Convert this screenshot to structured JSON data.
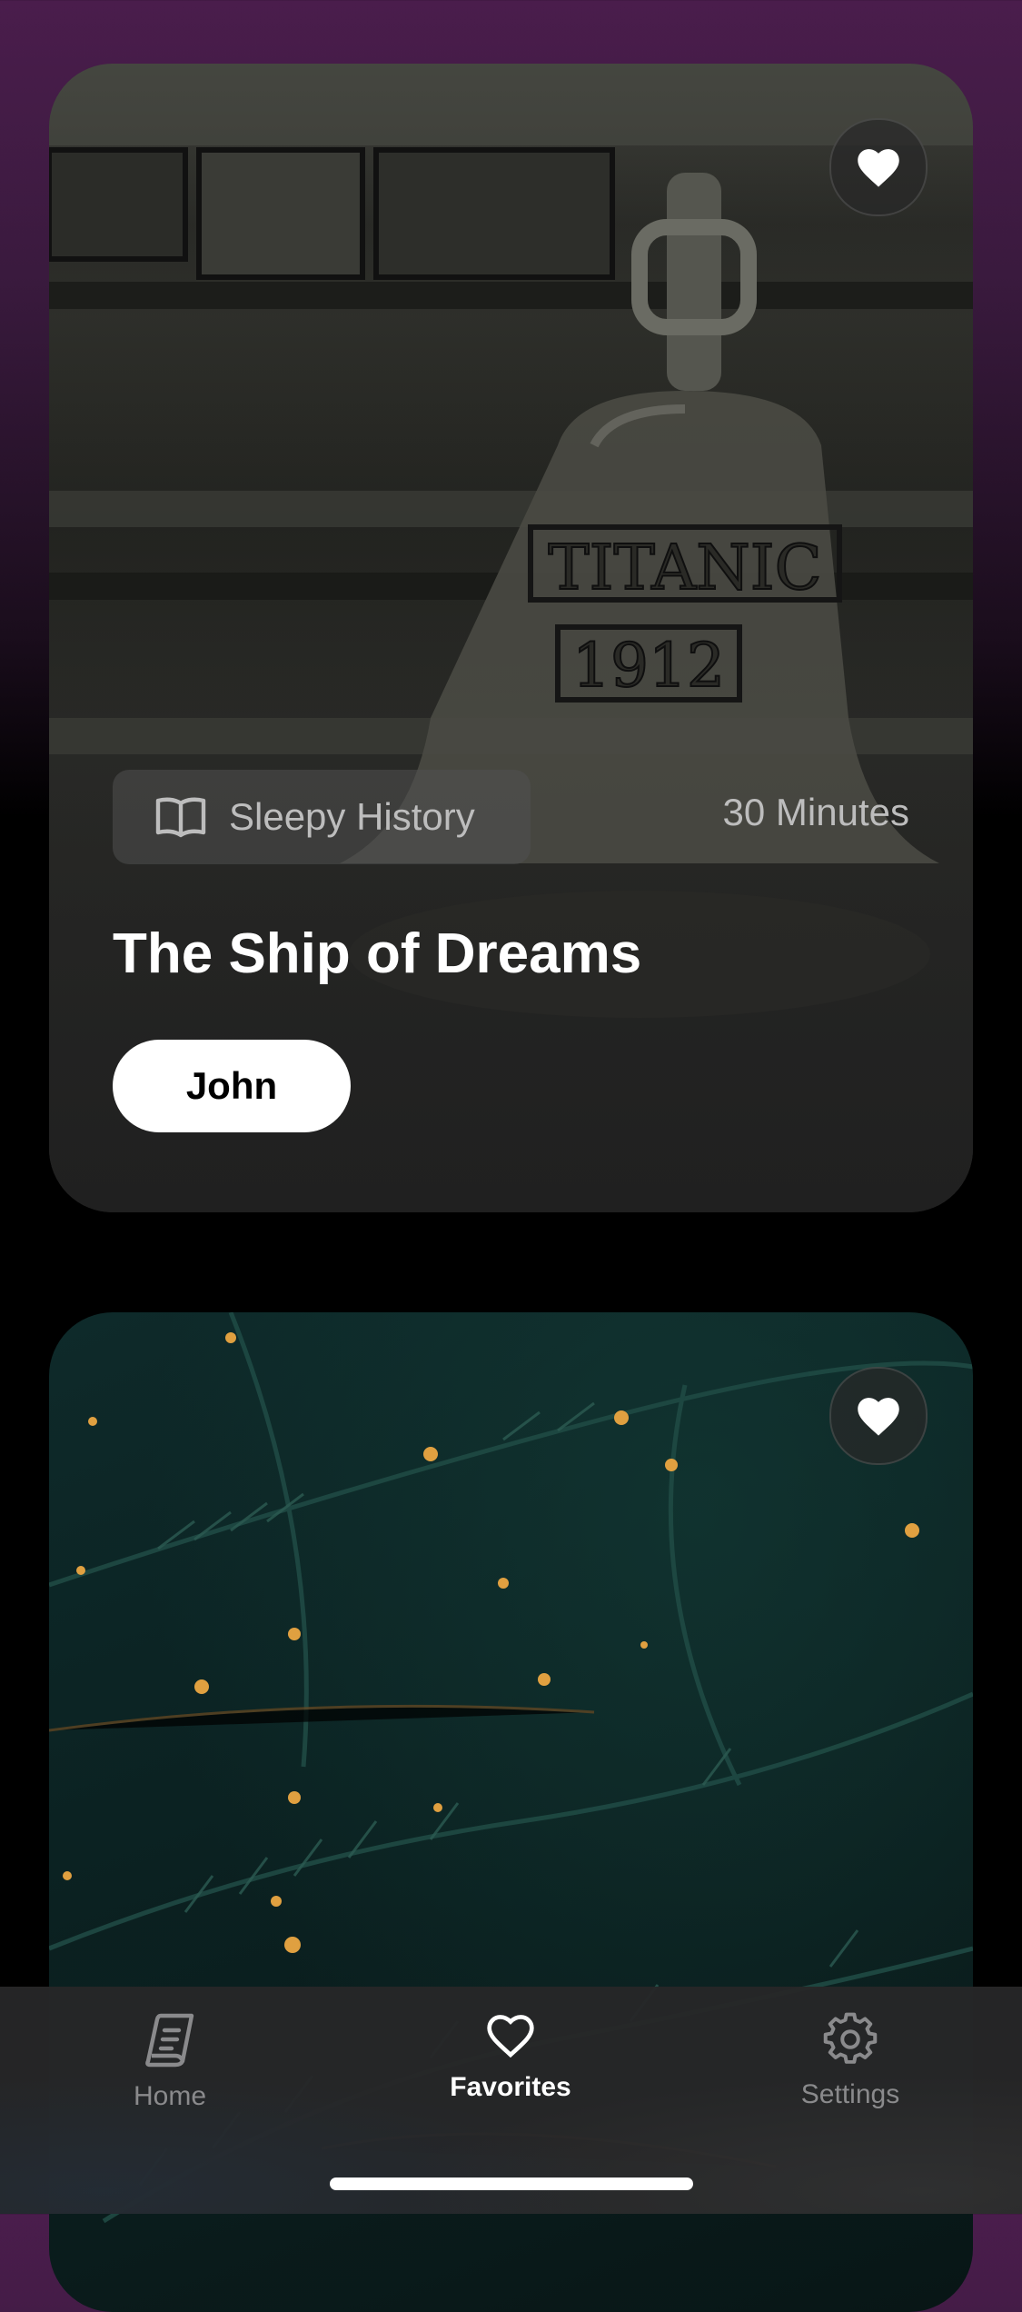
{
  "cards": [
    {
      "category": "Sleepy History",
      "duration": "30 Minutes",
      "title": "The Ship of Dreams",
      "narrator": "John",
      "favorited": true,
      "image_text": [
        "TITANIC",
        "1912"
      ]
    },
    {
      "favorited": true
    }
  ],
  "tabbar": {
    "tabs": [
      {
        "label": "Home",
        "icon": "book-icon",
        "active": false
      },
      {
        "label": "Favorites",
        "icon": "heart-icon",
        "active": true
      },
      {
        "label": "Settings",
        "icon": "gear-icon",
        "active": false
      }
    ]
  },
  "colors": {
    "accent_active": "#ffffff",
    "inactive": "#8a8a8c",
    "top_gradient": "#4a1d4c"
  }
}
